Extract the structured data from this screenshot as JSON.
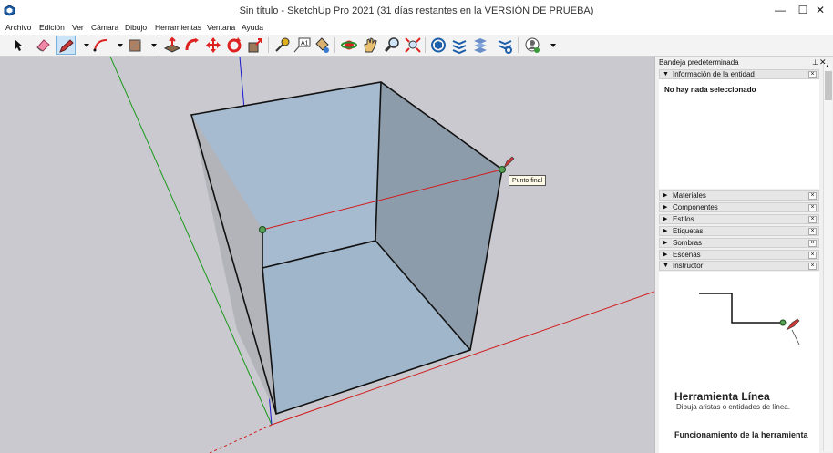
{
  "window": {
    "title": "Sin título - SketchUp Pro 2021 (31 días restantes en la VERSIÓN DE PRUEBA)",
    "minimize": "—",
    "maximize": "☐",
    "close": "✕"
  },
  "menu": [
    "Archivo",
    "Edición",
    "Ver",
    "Cámara",
    "Dibujo",
    "Herramientas",
    "Ventana",
    "Ayuda"
  ],
  "toolbar": {
    "active_tool": "line-tool",
    "tools": [
      "select",
      "eraser",
      "line",
      "arc",
      "shape",
      "push-pull",
      "move",
      "rotate",
      "scale",
      "tape",
      "text",
      "paint",
      "orbit",
      "pan",
      "zoom",
      "zoom-extents",
      "warehouse",
      "extension-warehouse",
      "layout",
      "style-builder",
      "account"
    ]
  },
  "viewport": {
    "tooltip": "Punto final",
    "colors": {
      "background": "#c9c9cf",
      "face_front": "#a9bfd3",
      "face_side": "#9aa8b8",
      "red_axis": "#d21a1a",
      "green_axis": "#1a9a1a",
      "blue_axis": "#1a1ad0",
      "inference_point": "#55a055"
    }
  },
  "tray": {
    "title": "Bandeja predeterminada",
    "pin": "📌",
    "close": "✕",
    "entity_info": {
      "label": "Información de la entidad",
      "message": "No hay nada seleccionado"
    },
    "panels": [
      {
        "label": "Materiales"
      },
      {
        "label": "Componentes"
      },
      {
        "label": "Estilos"
      },
      {
        "label": "Etiquetas"
      },
      {
        "label": "Sombras"
      },
      {
        "label": "Escenas"
      }
    ],
    "instructor": {
      "label": "Instructor",
      "heading": "Herramienta Línea",
      "description": "Dibuja aristas o entidades de línea.",
      "section": "Funcionamiento de la herramienta"
    }
  }
}
